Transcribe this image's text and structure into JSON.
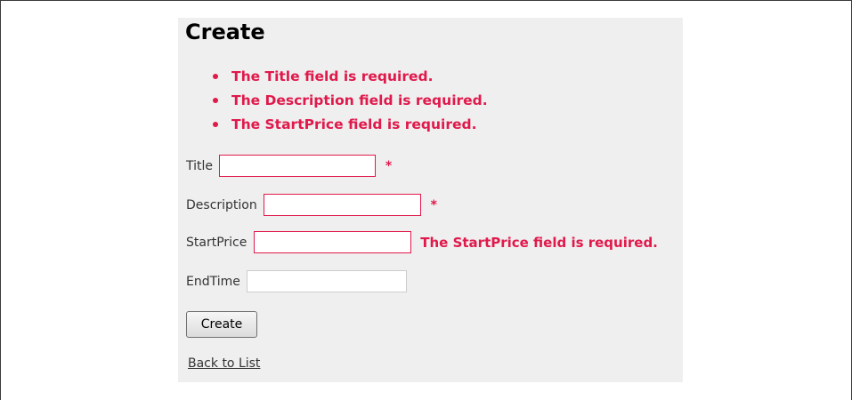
{
  "page": {
    "title": "Create"
  },
  "colors": {
    "error": "#e0194b",
    "panel_background": "#efefef",
    "invalid_border": "#e0194b"
  },
  "validation_summary": [
    "The Title field is required.",
    "The Description field is required.",
    "The StartPrice field is required."
  ],
  "fields": {
    "title": {
      "label": "Title",
      "value": "",
      "marker": "*"
    },
    "description": {
      "label": "Description",
      "value": "",
      "marker": "*"
    },
    "start_price": {
      "label": "StartPrice",
      "value": "",
      "message": "The StartPrice field is required."
    },
    "end_time": {
      "label": "EndTime",
      "value": ""
    }
  },
  "actions": {
    "create_label": "Create",
    "back_link": "Back to List"
  }
}
